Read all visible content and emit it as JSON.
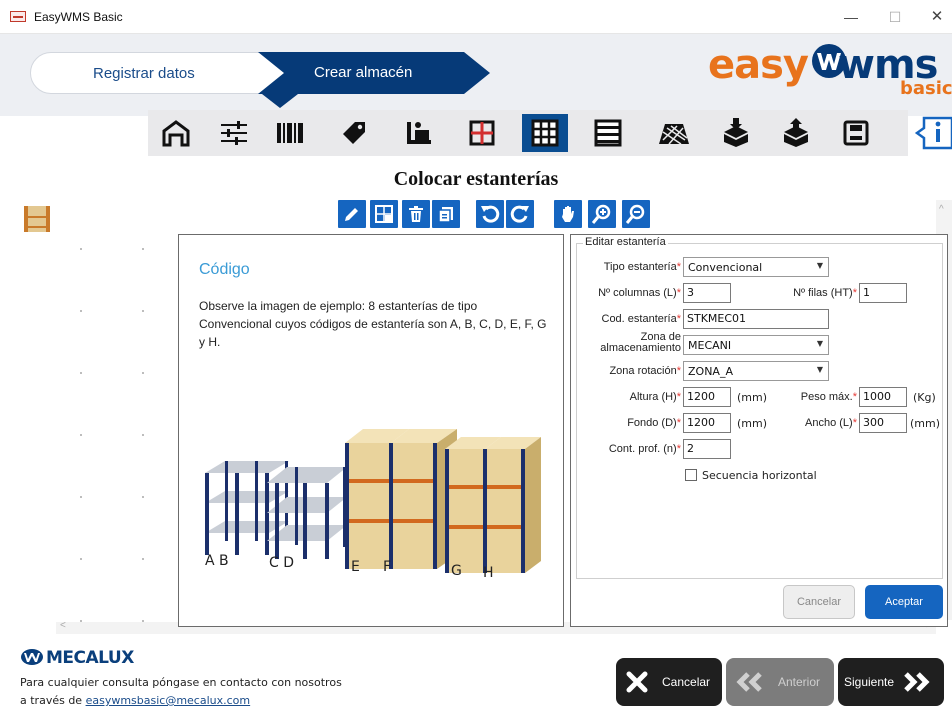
{
  "window": {
    "title": "EasyWMS Basic",
    "minimize": "—",
    "maximize": "☐",
    "close": "✕"
  },
  "steps": [
    {
      "label": "Registrar datos"
    },
    {
      "label": "Crear almacén"
    }
  ],
  "brand": {
    "easy": "easy",
    "wms": "wms",
    "basic": "basic"
  },
  "toolbar": {
    "items": [
      "warehouse-icon",
      "sliders-icon",
      "barcode-icon",
      "tag-icon",
      "worker-icon",
      "grid-red-icon",
      "rack-grid-icon",
      "shelf-icon",
      "floor-icon",
      "box-in-icon",
      "box-out-icon",
      "save-icon"
    ],
    "active_index": 6,
    "info": "info-icon"
  },
  "page": {
    "title": "Colocar estanterías"
  },
  "edit_tools": [
    "pencil-icon",
    "grid-select-icon",
    "trash-icon",
    "copy-icon",
    "undo-icon",
    "redo-icon",
    "hand-icon",
    "zoom-in-icon",
    "zoom-out-icon"
  ],
  "help": {
    "title": "Código",
    "text": "Observe la imagen de ejemplo: 8 estanterías de tipo Convencional cuyos códigos de estantería son A, B, C, D, E, F, G y H.",
    "rack_labels": [
      "A B",
      "C D",
      "E",
      "F",
      "G",
      "H"
    ]
  },
  "form": {
    "legend": "Editar estantería",
    "tipo_label": "Tipo estantería",
    "tipo_value": "Convencional",
    "columnas_label": "Nº columnas (L)",
    "columnas_value": "3",
    "filas_label": "Nº filas (HT)",
    "filas_value": "1",
    "cod_label": "Cod. estantería",
    "cod_value": "STKMEC01",
    "zona_alm_label_1": "Zona de",
    "zona_alm_label_2": "almacenamiento",
    "zona_alm_value": "MECANI",
    "zona_rot_label": "Zona rotación",
    "zona_rot_value": "ZONA_A",
    "altura_label": "Altura (H)",
    "altura_value": "1200",
    "altura_unit": "(mm)",
    "peso_label": "Peso máx.",
    "peso_value": "1000",
    "peso_unit": "(Kg)",
    "fondo_label": "Fondo (D)",
    "fondo_value": "1200",
    "fondo_unit": "(mm)",
    "ancho_label": "Ancho (L)",
    "ancho_value": "300",
    "ancho_unit": "(mm)",
    "cont_label": "Cont. prof. (n)",
    "cont_value": "2",
    "secuencia_label": "Secuencia horizontal",
    "secuencia_checked": false,
    "required_mark": "*",
    "cancel": "Cancelar",
    "accept": "Aceptar"
  },
  "footer": {
    "company": "MECALUX",
    "contact_1": "Para cualquier consulta póngase en contacto con nosotros",
    "contact_2_prefix": "a través de ",
    "email": "easywmsbasic@mecalux.com",
    "cancel": "Cancelar",
    "previous": "Anterior",
    "next": "Siguiente"
  },
  "colors": {
    "primary": "#063a78",
    "accent": "#e8731c",
    "button_blue": "#1565c0",
    "help_title": "#3a9bd6"
  }
}
